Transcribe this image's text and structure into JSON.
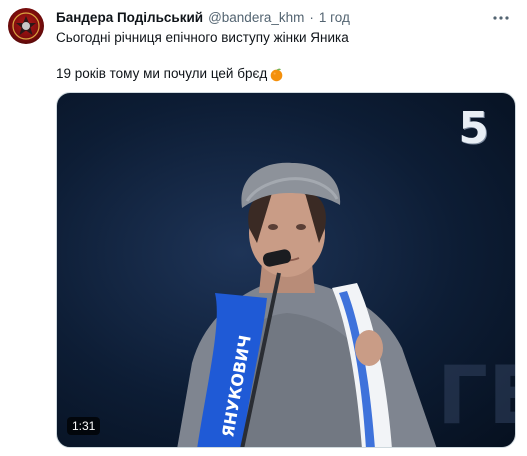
{
  "tweet": {
    "author_name": "Бандера Подільський",
    "author_handle": "@bandera_khm",
    "separator": "·",
    "timestamp": "1 год",
    "text_line1": "Сьогодні річниця епічного виступу жінки Яника",
    "text_line2": "19 років тому ми почули цей брєд",
    "emoji": "orange-fruit-icon"
  },
  "media": {
    "type": "video",
    "channel_logo_text": "5",
    "duration": "1:31",
    "scarf_text": "ЯНУКОВИЧ"
  },
  "colors": {
    "text_primary": "#0f1419",
    "text_secondary": "#536471",
    "scarf_blue": "#1f5ad6",
    "video_bg": "#0d1d35"
  }
}
